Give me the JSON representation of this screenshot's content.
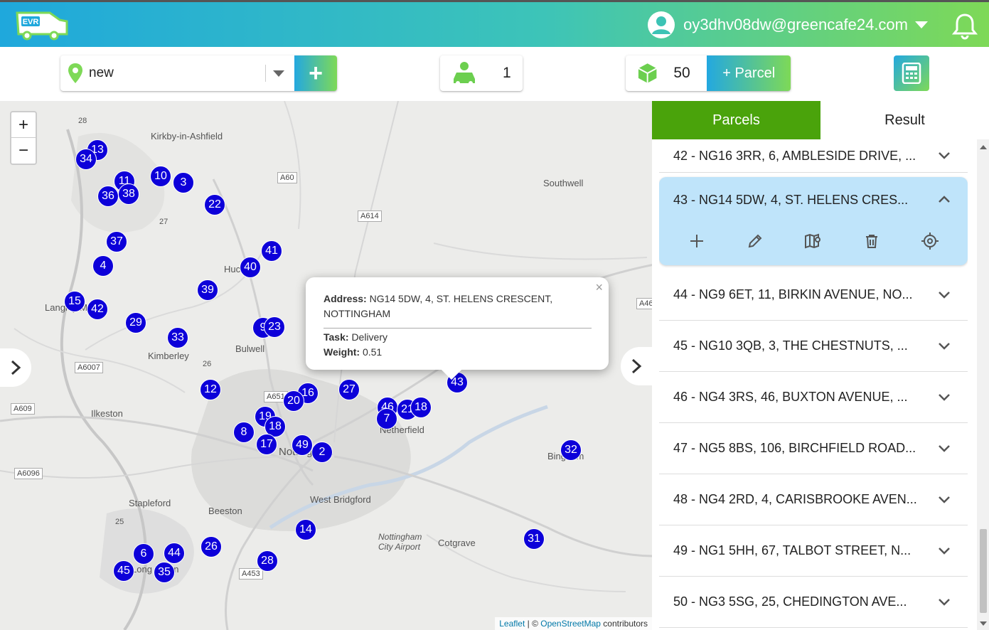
{
  "header": {
    "logo_text": "EVR",
    "user_email": "oy3dhv08dw@greencafe24.com"
  },
  "toolbar": {
    "location_value": "new",
    "add_label": "+",
    "drivers_count": "1",
    "parcels_count": "50",
    "add_parcel_label": "+ Parcel"
  },
  "map": {
    "zoom_in": "+",
    "zoom_out": "−",
    "places": [
      "Kirkby-in-Ashfield",
      "Southwell",
      "Hucknall",
      "Bulwell",
      "Kimberley",
      "Ilkeston",
      "Langley Mill",
      "Netherfield",
      "Nottingham",
      "Bingham",
      "West Bridgford",
      "Stapleford",
      "Beeston",
      "Long Eaton",
      "Cotgrave",
      "Nottingham City Airport"
    ],
    "roads": [
      "A60",
      "A614",
      "A6007",
      "A609",
      "A6096",
      "A651",
      "A453",
      "A46",
      "28",
      "27",
      "26",
      "25"
    ],
    "markers": [
      "13",
      "34",
      "11",
      "10",
      "3",
      "36",
      "38",
      "22",
      "37",
      "41",
      "4",
      "40",
      "39",
      "15",
      "42",
      "29",
      "9",
      "23",
      "33",
      "12",
      "16",
      "20",
      "27",
      "46",
      "21",
      "18",
      "43",
      "7",
      "19",
      "8",
      "18",
      "17",
      "49",
      "2",
      "32",
      "14",
      "31",
      "6",
      "44",
      "26",
      "45",
      "35",
      "28"
    ],
    "popup": {
      "address_label": "Address:",
      "address_value": "NG14 5DW, 4, ST. HELENS CRESCENT, NOTTINGHAM",
      "task_label": "Task:",
      "task_value": "Delivery",
      "weight_label": "Weight:",
      "weight_value": "0.51",
      "close": "×"
    },
    "attribution": {
      "leaflet": "Leaflet",
      "sep": " | © ",
      "osm": "OpenStreetMap",
      "suffix": " contributors"
    }
  },
  "panel": {
    "tabs": [
      "Parcels",
      "Result"
    ],
    "active_tab": "Parcels",
    "rows": [
      "42 - NG16 3RR, 6, AMBLESIDE DRIVE, ...",
      "43 - NG14 5DW, 4, ST. HELENS CRES...",
      "44 - NG9 6ET, 11, BIRKIN AVENUE, NO...",
      "45 - NG10 3QB, 3, THE CHESTNUTS, ...",
      "46 - NG4 3RS, 46, BUXTON AVENUE, ...",
      "47 - NG5 8BS, 106, BIRCHFIELD ROAD...",
      "48 - NG4 2RD, 4, CARISBROOKE AVEN...",
      "49 - NG1 5HH, 67, TALBOT STREET, N...",
      "50 - NG3 5SG, 25, CHEDINGTON AVE..."
    ]
  },
  "colors": {
    "marker": "#0d00d9",
    "tab_active": "#4aa30b",
    "expanded_row": "#bfe4fa",
    "gradient_start": "#23a8e0",
    "gradient_end": "#7ed957"
  }
}
